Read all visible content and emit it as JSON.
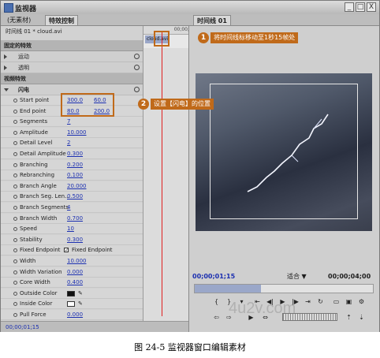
{
  "window": {
    "title": "监视器",
    "buttons": [
      "_",
      "□",
      "X"
    ]
  },
  "tabs": {
    "empty": "(无素材)",
    "effect_controls": "特效控制",
    "timeline": "时间线 01"
  },
  "sequence": {
    "label": "时间线 01 * cloud.avi",
    "ruler_time": "00;00;",
    "clip_name": "cloud.avi"
  },
  "sections": {
    "fixed": "固定的特效",
    "motion": "运动",
    "opacity": "透明",
    "video": "视频特效",
    "lightning": "闪电"
  },
  "properties": [
    {
      "label": "Start point",
      "value": "300.0",
      "value2": "60.0"
    },
    {
      "label": "End point",
      "value": "80.0",
      "value2": "200.0"
    },
    {
      "label": "Segments",
      "value": "7"
    },
    {
      "label": "Amplitude",
      "value": "10.000"
    },
    {
      "label": "Detail Level",
      "value": "2"
    },
    {
      "label": "Detail Amplitude",
      "value": "0.300"
    },
    {
      "label": "Branching",
      "value": "0.200"
    },
    {
      "label": "Rebranching",
      "value": "0.100"
    },
    {
      "label": "Branch Angle",
      "value": "20.000"
    },
    {
      "label": "Branch Seg. Len...",
      "value": "0.500"
    },
    {
      "label": "Branch Segments",
      "value": "4"
    },
    {
      "label": "Branch Width",
      "value": "0.700"
    },
    {
      "label": "Speed",
      "value": "10"
    },
    {
      "label": "Stability",
      "value": "0.300"
    },
    {
      "label": "Fixed Endpoint",
      "value": "Fixed Endpoint"
    },
    {
      "label": "Width",
      "value": "10.000"
    },
    {
      "label": "Width Variation",
      "value": "0.000"
    },
    {
      "label": "Core Width",
      "value": "0.400"
    },
    {
      "label": "Outside Color",
      "value": ""
    },
    {
      "label": "Inside Color",
      "value": ""
    },
    {
      "label": "Pull Force",
      "value": "0.000"
    }
  ],
  "left_footer": "00;00;01;15",
  "monitor": {
    "current_tc": "00;00;01;15",
    "fit": "适合",
    "duration_tc": "00;00;04;00",
    "scrub_position": 0.37
  },
  "callouts": {
    "one_num": "1",
    "one_text": "将时间线标移动至1秒15帧处",
    "two_num": "2",
    "two_text": "设置【闪电】的位置"
  },
  "caption": "图 24-5    监视器窗口编辑素材",
  "watermark": "4u2v.com"
}
